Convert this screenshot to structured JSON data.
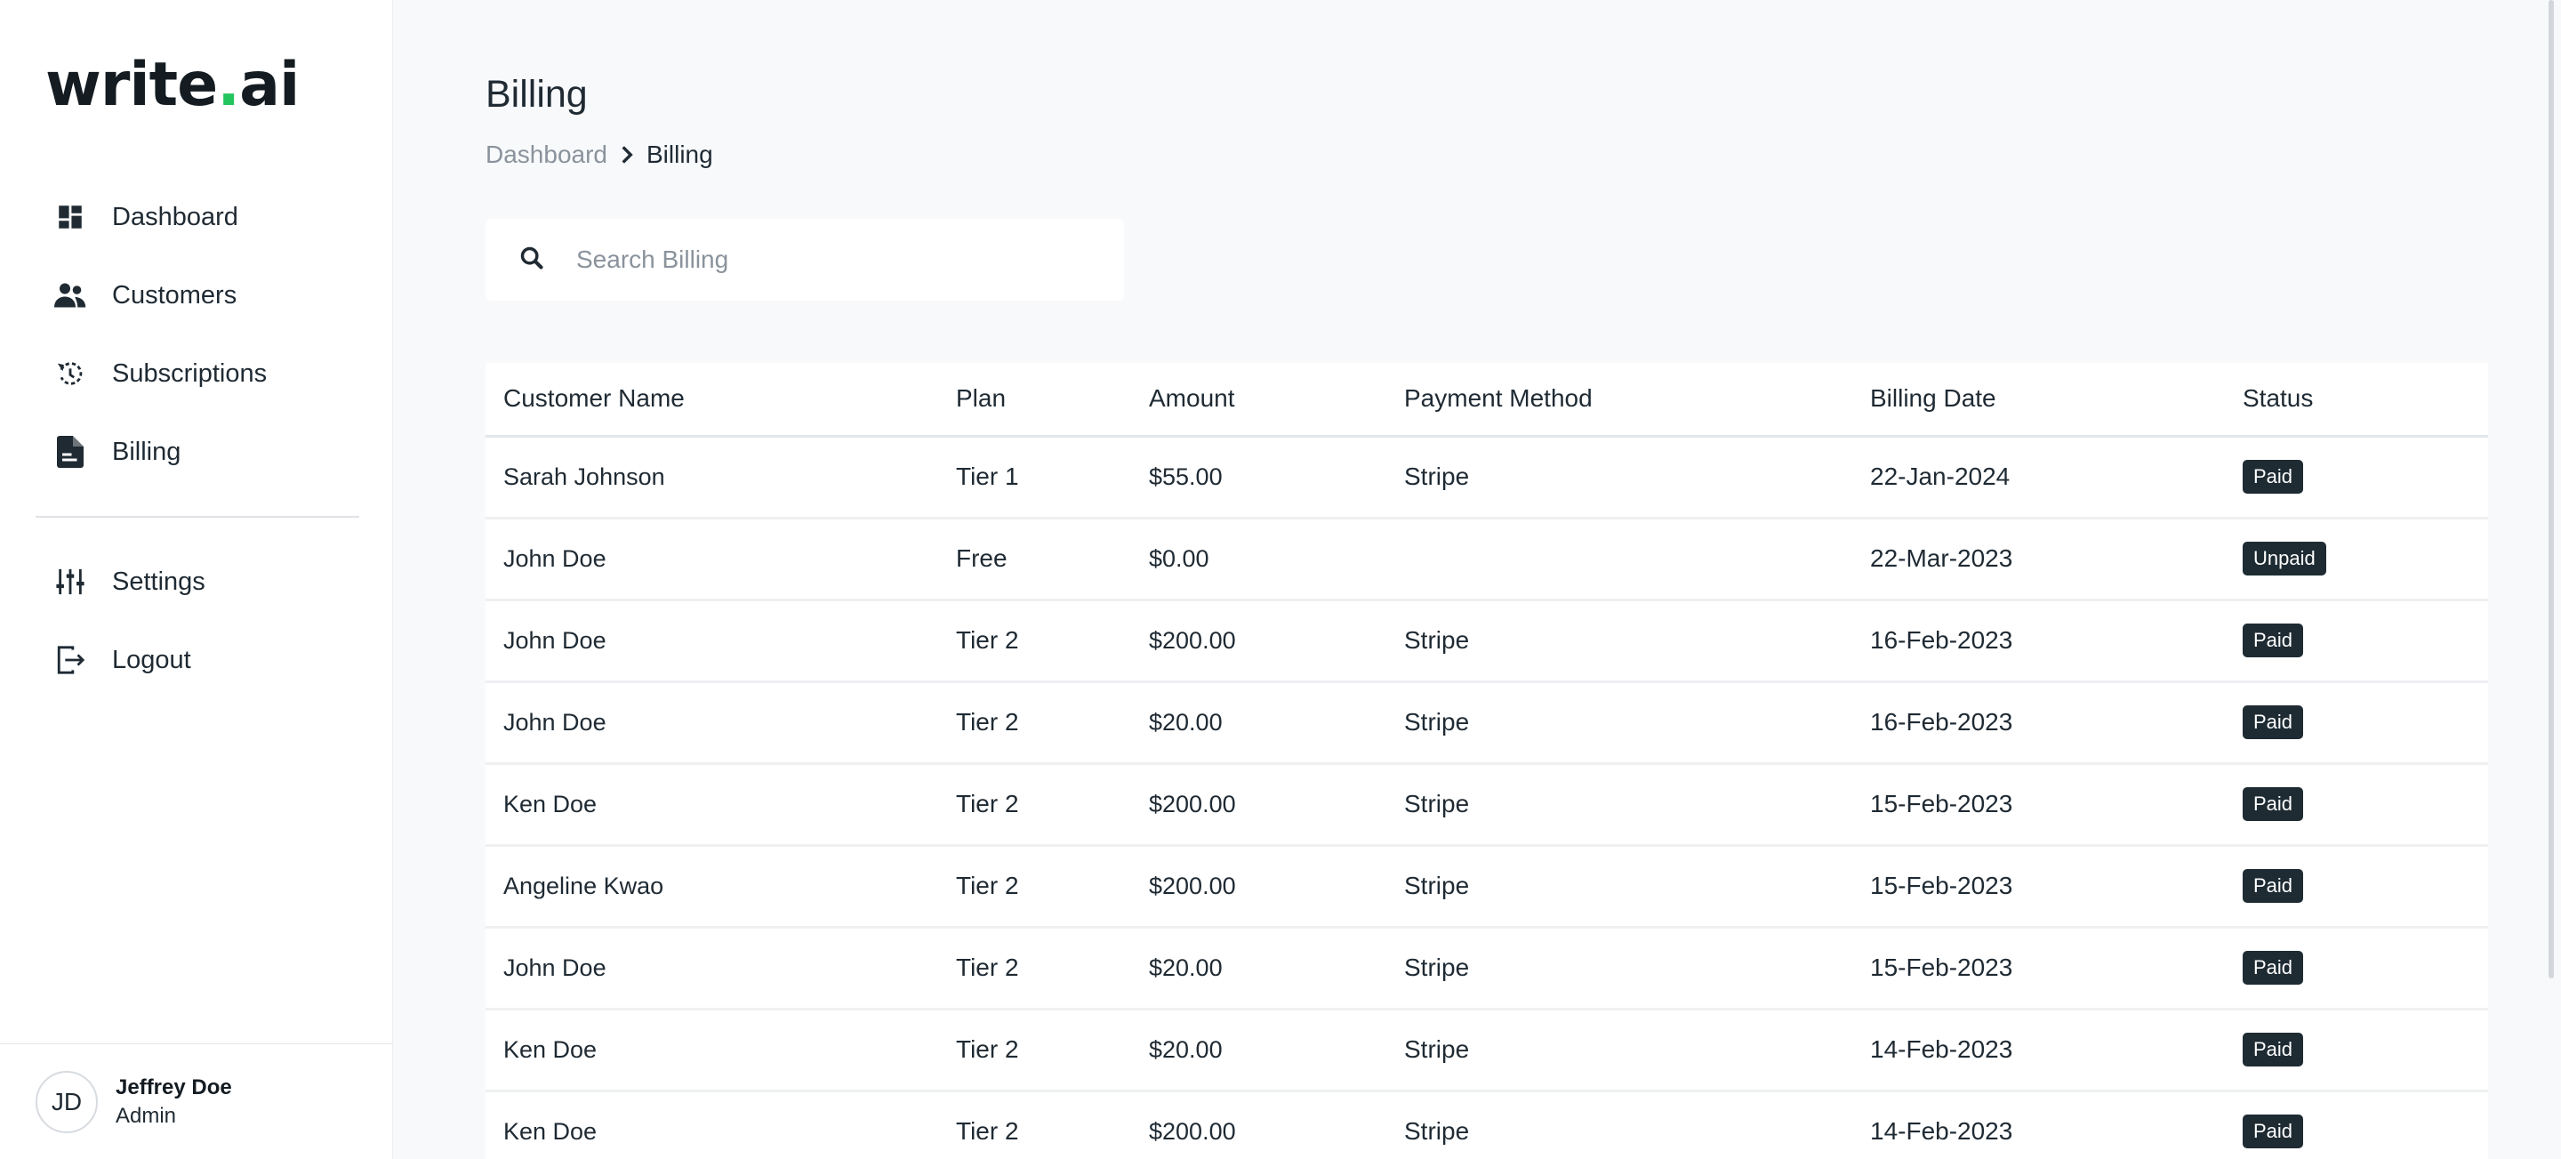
{
  "logo": {
    "part1": "write",
    "dot": ".",
    "part2": "ai"
  },
  "nav": [
    {
      "key": "dashboard",
      "label": "Dashboard",
      "icon": "dashboard-icon"
    },
    {
      "key": "customers",
      "label": "Customers",
      "icon": "users-icon"
    },
    {
      "key": "subscriptions",
      "label": "Subscriptions",
      "icon": "refresh-icon"
    },
    {
      "key": "billing",
      "label": "Billing",
      "icon": "document-icon"
    }
  ],
  "nav_secondary": [
    {
      "key": "settings",
      "label": "Settings",
      "icon": "sliders-icon"
    },
    {
      "key": "logout",
      "label": "Logout",
      "icon": "logout-icon"
    }
  ],
  "user": {
    "initials": "JD",
    "name": "Jeffrey Doe",
    "role": "Admin"
  },
  "page": {
    "title": "Billing",
    "breadcrumb": {
      "parent": "Dashboard",
      "current": "Billing"
    }
  },
  "search": {
    "placeholder": "Search Billing",
    "value": ""
  },
  "table": {
    "columns": [
      "Customer Name",
      "Plan",
      "Amount",
      "Payment Method",
      "Billing Date",
      "Status"
    ],
    "rows": [
      {
        "name": "Sarah Johnson",
        "plan": "Tier 1",
        "amount": "$55.00",
        "method": "Stripe",
        "date": "22-Jan-2024",
        "status": "Paid"
      },
      {
        "name": "John Doe",
        "plan": "Free",
        "amount": "$0.00",
        "method": "",
        "date": "22-Mar-2023",
        "status": "Unpaid"
      },
      {
        "name": "John Doe",
        "plan": "Tier 2",
        "amount": "$200.00",
        "method": "Stripe",
        "date": "16-Feb-2023",
        "status": "Paid"
      },
      {
        "name": "John Doe",
        "plan": "Tier 2",
        "amount": "$20.00",
        "method": "Stripe",
        "date": "16-Feb-2023",
        "status": "Paid"
      },
      {
        "name": "Ken Doe",
        "plan": "Tier 2",
        "amount": "$200.00",
        "method": "Stripe",
        "date": "15-Feb-2023",
        "status": "Paid"
      },
      {
        "name": "Angeline Kwao",
        "plan": "Tier 2",
        "amount": "$200.00",
        "method": "Stripe",
        "date": "15-Feb-2023",
        "status": "Paid"
      },
      {
        "name": "John Doe",
        "plan": "Tier 2",
        "amount": "$20.00",
        "method": "Stripe",
        "date": "15-Feb-2023",
        "status": "Paid"
      },
      {
        "name": "Ken Doe",
        "plan": "Tier 2",
        "amount": "$20.00",
        "method": "Stripe",
        "date": "14-Feb-2023",
        "status": "Paid"
      },
      {
        "name": "Ken Doe",
        "plan": "Tier 2",
        "amount": "$200.00",
        "method": "Stripe",
        "date": "14-Feb-2023",
        "status": "Paid"
      }
    ]
  },
  "colors": {
    "accent": "#22c55e",
    "badge_bg": "#1e2b33",
    "text": "#1f2a33",
    "muted": "#8a939c"
  }
}
